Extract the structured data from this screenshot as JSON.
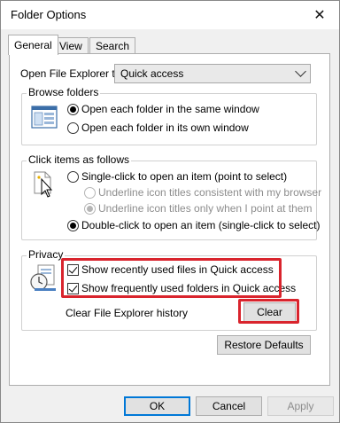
{
  "window": {
    "title": "Folder Options"
  },
  "tabs": [
    {
      "label": "General"
    },
    {
      "label": "View"
    },
    {
      "label": "Search"
    }
  ],
  "open_explorer": {
    "label": "Open File Explorer to:",
    "value": "Quick access"
  },
  "browse_folders": {
    "title": "Browse folders",
    "options": [
      {
        "label": "Open each folder in the same window",
        "checked": true
      },
      {
        "label": "Open each folder in its own window",
        "checked": false
      }
    ]
  },
  "click_items": {
    "title": "Click items as follows",
    "single_click": "Single-click to open an item (point to select)",
    "underline_consistent": "Underline icon titles consistent with my browser",
    "underline_point": "Underline icon titles only when I point at them",
    "double_click": "Double-click to open an item (single-click to select)"
  },
  "privacy": {
    "title": "Privacy",
    "show_recent_files": "Show recently used files in Quick access",
    "show_frequent_folders": "Show frequently used folders in Quick access",
    "clear_history_label": "Clear File Explorer history",
    "clear_button": "Clear"
  },
  "restore_defaults": "Restore Defaults",
  "buttons": {
    "ok": "OK",
    "cancel": "Cancel",
    "apply": "Apply"
  },
  "colors": {
    "highlight": "#d9242d",
    "accent": "#0078d7"
  }
}
